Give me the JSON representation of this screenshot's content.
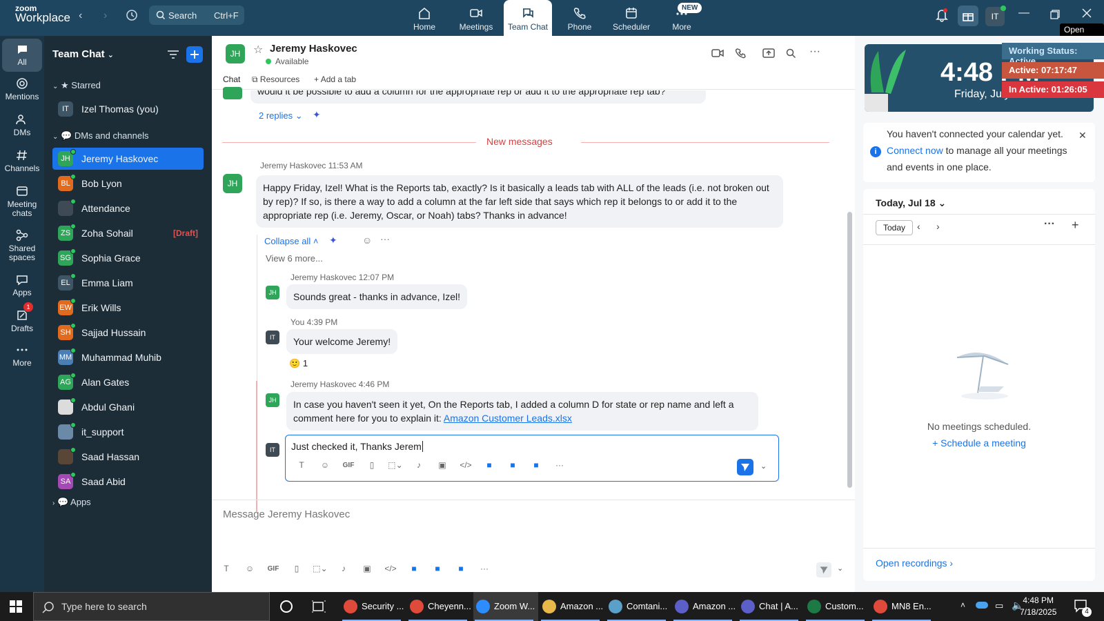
{
  "app": {
    "logo_line1": "zoom",
    "logo_line2": "Workplace"
  },
  "topbar": {
    "search_label": "Search",
    "search_shortcut": "Ctrl+F",
    "tabs": [
      {
        "label": "Home",
        "icon": "home-icon"
      },
      {
        "label": "Meetings",
        "icon": "video-icon"
      },
      {
        "label": "Team Chat",
        "icon": "chat-icon"
      },
      {
        "label": "Phone",
        "icon": "phone-icon"
      },
      {
        "label": "Scheduler",
        "icon": "calendar-icon"
      },
      {
        "label": "More",
        "icon": "more-icon"
      }
    ],
    "new_badge": "NEW",
    "avatar_initials": "IT",
    "open_app_tooltip": "Open App"
  },
  "rail": {
    "items": [
      {
        "label": "All",
        "icon": "chat-bubble-icon"
      },
      {
        "label": "Mentions",
        "icon": "at-icon"
      },
      {
        "label": "DMs",
        "icon": "people-icon"
      },
      {
        "label": "Channels",
        "icon": "hash-icon"
      },
      {
        "label": "Meeting chats",
        "icon": "meeting-chat-icon"
      },
      {
        "label": "Shared spaces",
        "icon": "shared-spaces-icon"
      },
      {
        "label": "Apps",
        "icon": "apps-icon"
      },
      {
        "label": "Drafts",
        "icon": "drafts-icon"
      },
      {
        "label": "More",
        "icon": "ellipsis-icon"
      }
    ],
    "drafts_badge": "1"
  },
  "chatlist": {
    "header": "Team Chat",
    "starred_label": "Starred",
    "dms_label": "DMs and channels",
    "apps_label": "Apps",
    "starred": [
      {
        "initials": "IT",
        "name": "Izel Thomas (you)",
        "color": "#3e5566"
      }
    ],
    "contacts": [
      {
        "initials": "JH",
        "name": "Jeremy Haskovec",
        "color": "#2fa55a"
      },
      {
        "initials": "BL",
        "name": "Bob Lyon",
        "color": "#e06b1f"
      },
      {
        "initials": "",
        "name": "Attendance",
        "color": "#3e4a54"
      },
      {
        "initials": "ZS",
        "name": "Zoha Sohail",
        "color": "#2fa55a",
        "draft": "[Draft]"
      },
      {
        "initials": "SG",
        "name": "Sophia Grace",
        "color": "#2fa55a"
      },
      {
        "initials": "EL",
        "name": "Emma Liam",
        "color": "#3e5566"
      },
      {
        "initials": "EW",
        "name": "Erik Wills",
        "color": "#e06b1f"
      },
      {
        "initials": "SH",
        "name": "Sajjad Hussain",
        "color": "#e06b1f"
      },
      {
        "initials": "MM",
        "name": "Muhammad Muhib",
        "color": "#4a7fb5"
      },
      {
        "initials": "AG",
        "name": "Alan Gates",
        "color": "#2fa55a"
      },
      {
        "initials": "",
        "name": "Abdul Ghani",
        "color": "#dcdcdc"
      },
      {
        "initials": "",
        "name": "it_support",
        "color": "#6a8aa8"
      },
      {
        "initials": "",
        "name": "Saad Hassan",
        "color": "#5a4636"
      },
      {
        "initials": "SA",
        "name": "Saad Abid",
        "color": "#a54ab5"
      }
    ]
  },
  "chat": {
    "contact_initials": "JH",
    "contact_name": "Jeremy Haskovec",
    "contact_status": "Available",
    "tabs": {
      "chat": "Chat",
      "resources": "Resources",
      "add": "Add a tab"
    },
    "prev_message": "would it be possible to add a column for the appropriate rep or add it to the appropriate rep tab?",
    "replies_label": "2 replies",
    "new_messages": "New messages",
    "msg1": {
      "sender": "Jeremy Haskovec",
      "time": "11:53 AM",
      "text": "Happy Friday, Izel!  What is the Reports tab, exactly?  Is it basically a leads tab with ALL of the leads (i.e. not broken out by rep)?  If so, is there a way to add a column at the far left side that says which rep it belongs to or add it to the appropriate rep (i.e. Jeremy, Oscar, or Noah) tabs?  Thanks in advance!"
    },
    "collapse_label": "Collapse all",
    "view_more": "View 6 more...",
    "r1": {
      "sender": "Jeremy Haskovec",
      "time": "12:07 PM",
      "text": "Sounds great - thanks in advance, Izel!",
      "initials": "JH"
    },
    "r2": {
      "sender": "You",
      "time": "4:39 PM",
      "text": "Your welcome Jeremy!",
      "initials": "IT",
      "reaction": "🙂",
      "reaction_count": "1"
    },
    "r3": {
      "sender": "Jeremy Haskovec",
      "time": "4:46 PM",
      "text": "In case you haven't seen it yet, On the Reports tab, I added a column D for state or rep name and left a comment here for you to explain it:",
      "link": "Amazon Customer Leads.xlsx",
      "initials": "JH"
    },
    "reply_input": "Just checked it, Thanks Jerem",
    "reply_avatar": "IT",
    "gif_label": "GIF",
    "compose_placeholder": "Message Jeremy Haskovec"
  },
  "right": {
    "clock_time": "4:48 PM",
    "clock_date": "Friday, July 18",
    "working_status": "Working Status: Active",
    "active": "Active: 07:17:47",
    "inactive": "In Active: 01:26:05",
    "cal_notice_pre": "You haven't connected your calendar yet.",
    "cal_notice_link": "Connect now",
    "cal_notice_post": "to manage all your meetings and events in one place.",
    "cal_date": "Today, Jul 18",
    "today_btn": "Today",
    "no_meetings": "No meetings scheduled.",
    "schedule": "Schedule a meeting",
    "open_recordings": "Open recordings"
  },
  "taskbar": {
    "search_placeholder": "Type here to search",
    "apps": [
      {
        "label": "Security ...",
        "color": "#e04a3a"
      },
      {
        "label": "Cheyenn...",
        "color": "#e04a3a"
      },
      {
        "label": "Zoom W...",
        "color": "#2d8cff"
      },
      {
        "label": "Amazon ...",
        "color": "#e8b84a"
      },
      {
        "label": "Comtani...",
        "color": "#5aa0c8"
      },
      {
        "label": "Amazon ...",
        "color": "#5b5fc7"
      },
      {
        "label": "Chat | A...",
        "color": "#5b5fc7"
      },
      {
        "label": "Custom...",
        "color": "#1d7a44"
      },
      {
        "label": "MN8 En...",
        "color": "#e04a3a"
      }
    ],
    "time": "4:48 PM",
    "date": "7/18/2025",
    "notif_count": "4"
  }
}
